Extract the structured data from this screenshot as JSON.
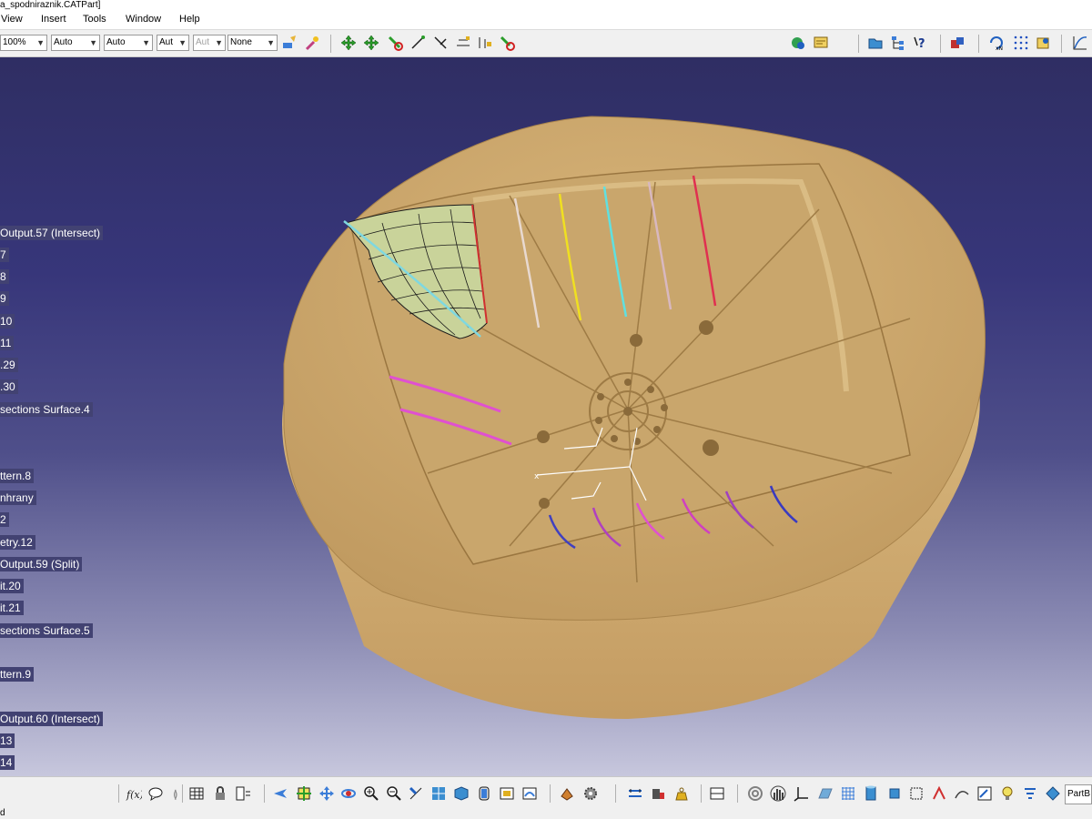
{
  "window": {
    "title": "a_spodniraznik.CATPart]"
  },
  "menu": [
    {
      "label": "View"
    },
    {
      "label": "Insert"
    },
    {
      "label": "Tools"
    },
    {
      "label": "Window"
    },
    {
      "label": "Help"
    }
  ],
  "toolbar": {
    "zoom_value": "100%",
    "line_type_value": "Auto",
    "line_weight_value": "Auto",
    "layer_value": "Aut",
    "disabled_value": "Aut",
    "rendering_value": "None"
  },
  "tree": {
    "items": [
      {
        "label": "Output.57 (Intersect)"
      },
      {
        "label": "7"
      },
      {
        "label": "8"
      },
      {
        "label": "9"
      },
      {
        "label": "10"
      },
      {
        "label": "11"
      },
      {
        "label": ".29"
      },
      {
        "label": ".30"
      },
      {
        "label": "sections Surface.4"
      },
      {
        "label": "ttern.8"
      },
      {
        "label": "nhrany"
      },
      {
        "label": "2"
      },
      {
        "label": "etry.12"
      },
      {
        "label": "Output.59 (Split)"
      },
      {
        "label": "it.20"
      },
      {
        "label": "it.21"
      },
      {
        "label": "sections Surface.5"
      },
      {
        "label": "ttern.9"
      },
      {
        "label": "Output.60 (Intersect)"
      },
      {
        "label": "13"
      },
      {
        "label": "14"
      }
    ]
  },
  "bottom_toolbar": {
    "workbench_label": "PartB"
  },
  "status": {
    "text": "d"
  },
  "colors": {
    "viewport_top": "#2f2e63",
    "viewport_bottom": "#c7c7dd",
    "part_color": "#c8a46c",
    "tree_highlight": "#424272"
  },
  "icons": [
    "fx-icon",
    "comment-icon",
    "lock-icon",
    "grid-icon",
    "fly-icon",
    "fit-all-icon",
    "pan-icon",
    "rotate-icon",
    "zoom-in-icon",
    "zoom-out-icon",
    "normal-view-icon",
    "multi-view-icon",
    "iso-view-icon",
    "hide-show-icon",
    "swap-icon",
    "shading-icon",
    "measure-icon",
    "apply-material-icon",
    "compass-icon",
    "snap-icon",
    "axis-icon",
    "plane-icon",
    "sketch-icon"
  ]
}
